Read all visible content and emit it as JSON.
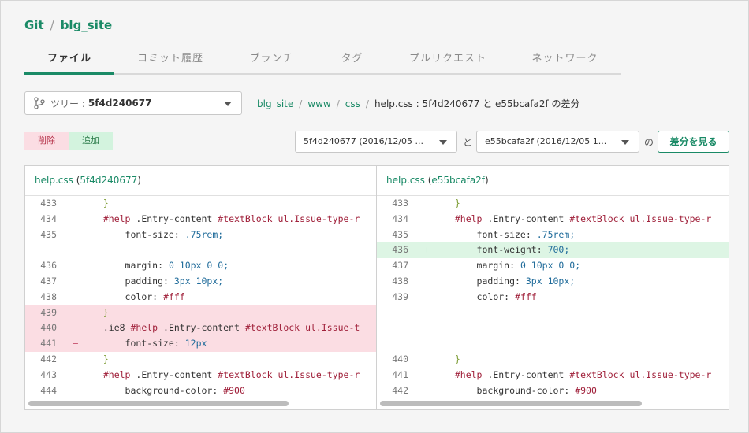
{
  "breadcrumb": {
    "root": "Git",
    "repo": "blg_site"
  },
  "tabs": [
    {
      "label": "ファイル",
      "active": true
    },
    {
      "label": "コミット履歴"
    },
    {
      "label": "ブランチ"
    },
    {
      "label": "タグ"
    },
    {
      "label": "プルリクエスト"
    },
    {
      "label": "ネットワーク"
    }
  ],
  "tree_select": {
    "label": "ツリー :",
    "value": "5f4d240677"
  },
  "path": {
    "repo": "blg_site",
    "dir1": "www",
    "dir2": "css",
    "current": "help.css : 5f4d240677 と e55bcafa2f の差分"
  },
  "legend": {
    "deleted": "削除",
    "added": "追加"
  },
  "compare": {
    "rev_a": "5f4d240677 (2016/12/05 ...",
    "joiner": "と",
    "rev_b": "e55bcafa2f (2016/12/05 1...",
    "suffix": "の",
    "button": "差分を見る"
  },
  "left_pane": {
    "file": "help.css",
    "rev": "5f4d240677",
    "lines": [
      {
        "num": "433",
        "mark": "",
        "type": "",
        "code": "  }"
      },
      {
        "num": "434",
        "mark": "",
        "type": "",
        "code": "  #help .Entry-content #textBlock ul.Issue-type-r"
      },
      {
        "num": "435",
        "mark": "",
        "type": "",
        "code": "      font-size: .75rem;"
      },
      {
        "num": "",
        "mark": "",
        "type": "",
        "code": ""
      },
      {
        "num": "436",
        "mark": "",
        "type": "",
        "code": "      margin: 0 10px 0 0;"
      },
      {
        "num": "437",
        "mark": "",
        "type": "",
        "code": "      padding: 3px 10px;"
      },
      {
        "num": "438",
        "mark": "",
        "type": "",
        "code": "      color: #fff"
      },
      {
        "num": "439",
        "mark": "—",
        "type": "del",
        "code": "  }"
      },
      {
        "num": "440",
        "mark": "—",
        "type": "del",
        "code": "  .ie8 #help .Entry-content #textBlock ul.Issue-t"
      },
      {
        "num": "441",
        "mark": "—",
        "type": "del",
        "code": "      font-size: 12px"
      },
      {
        "num": "442",
        "mark": "",
        "type": "",
        "code": "  }"
      },
      {
        "num": "443",
        "mark": "",
        "type": "",
        "code": "  #help .Entry-content #textBlock ul.Issue-type-r"
      },
      {
        "num": "444",
        "mark": "",
        "type": "",
        "code": "      background-color: #900"
      }
    ]
  },
  "right_pane": {
    "file": "help.css",
    "rev": "e55bcafa2f",
    "lines": [
      {
        "num": "433",
        "mark": "",
        "type": "",
        "code": "  }"
      },
      {
        "num": "434",
        "mark": "",
        "type": "",
        "code": "  #help .Entry-content #textBlock ul.Issue-type-r"
      },
      {
        "num": "435",
        "mark": "",
        "type": "",
        "code": "      font-size: .75rem;"
      },
      {
        "num": "436",
        "mark": "+",
        "type": "add",
        "code": "      font-weight: 700;"
      },
      {
        "num": "437",
        "mark": "",
        "type": "",
        "code": "      margin: 0 10px 0 0;"
      },
      {
        "num": "438",
        "mark": "",
        "type": "",
        "code": "      padding: 3px 10px;"
      },
      {
        "num": "439",
        "mark": "",
        "type": "",
        "code": "      color: #fff"
      },
      {
        "num": "",
        "mark": "",
        "type": "",
        "code": ""
      },
      {
        "num": "",
        "mark": "",
        "type": "",
        "code": ""
      },
      {
        "num": "",
        "mark": "",
        "type": "",
        "code": ""
      },
      {
        "num": "440",
        "mark": "",
        "type": "",
        "code": "  }"
      },
      {
        "num": "441",
        "mark": "",
        "type": "",
        "code": "  #help .Entry-content #textBlock ul.Issue-type-r"
      },
      {
        "num": "442",
        "mark": "",
        "type": "",
        "code": "      background-color: #900"
      }
    ]
  },
  "colors": {
    "accent": "#1a8a66",
    "deleted_bg": "#fbdde3",
    "added_bg": "#d3f3de"
  }
}
